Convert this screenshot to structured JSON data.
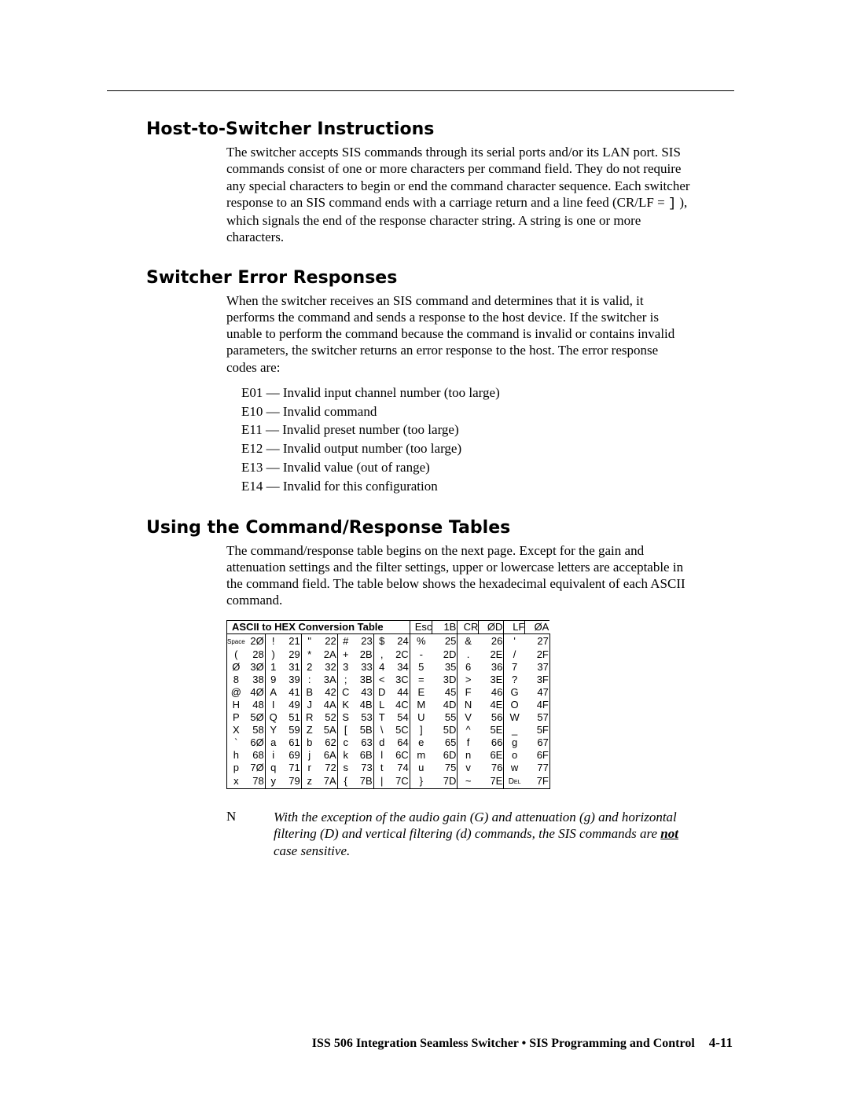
{
  "headings": {
    "h1": "Host-to-Switcher Instructions",
    "h2": "Switcher Error Responses",
    "h3": "Using the Command/Response Tables"
  },
  "paragraphs": {
    "p1a": "The switcher accepts SIS commands through its serial ports and/or its LAN port.  SIS commands consist of one or more characters per command field.  They do not require any special characters to begin or end the command character sequence.  Each switcher response to an SIS command ends with a carriage return and a line feed (CR/LF = ",
    "p1b": "), which signals the end of the response character string.  A string is one or more characters.",
    "crlf_symbol": "]",
    "p2": "When the switcher receives an SIS command and determines that it is valid, it performs the command and sends a response to the host device.  If the switcher is unable to perform the command because the command is invalid or contains invalid parameters, the switcher returns an error response to the host.  The error response codes are:",
    "p3": "The command/response table begins on the next page.  Except for the gain and attenuation settings and the filter settings, upper or lowercase letters are acceptable in the command field.  The table below shows the hexadecimal equivalent of each ASCII command."
  },
  "errors": [
    "E01 — Invalid input channel number (too large)",
    "E10 — Invalid command",
    "E11 — Invalid preset number (too large)",
    "E12 — Invalid output number (too large)",
    "E13 — Invalid value (out of range)",
    "E14 — Invalid for this configuration"
  ],
  "table": {
    "title": "ASCII to HEX  Conversion Table",
    "header_extras": [
      {
        "ch": "Esc",
        "hex": "1B"
      },
      {
        "ch": "CR",
        "hex": "ØD"
      },
      {
        "ch": "LF",
        "hex": "ØA"
      }
    ],
    "rows": [
      [
        {
          "ch": "Space",
          "hex": "2Ø"
        },
        {
          "ch": "!",
          "hex": "21"
        },
        {
          "ch": "\"",
          "hex": "22"
        },
        {
          "ch": "#",
          "hex": "23"
        },
        {
          "ch": "$",
          "hex": "24"
        },
        {
          "ch": "%",
          "hex": "25"
        },
        {
          "ch": "&",
          "hex": "26"
        },
        {
          "ch": "'",
          "hex": "27"
        }
      ],
      [
        {
          "ch": "(",
          "hex": "28"
        },
        {
          "ch": ")",
          "hex": "29"
        },
        {
          "ch": "*",
          "hex": "2A"
        },
        {
          "ch": "+",
          "hex": "2B"
        },
        {
          "ch": ",",
          "hex": "2C"
        },
        {
          "ch": "-",
          "hex": "2D"
        },
        {
          "ch": ".",
          "hex": "2E"
        },
        {
          "ch": "/",
          "hex": "2F"
        }
      ],
      [
        {
          "ch": "Ø",
          "hex": "3Ø"
        },
        {
          "ch": "1",
          "hex": "31"
        },
        {
          "ch": "2",
          "hex": "32"
        },
        {
          "ch": "3",
          "hex": "33"
        },
        {
          "ch": "4",
          "hex": "34"
        },
        {
          "ch": "5",
          "hex": "35"
        },
        {
          "ch": "6",
          "hex": "36"
        },
        {
          "ch": "7",
          "hex": "37"
        }
      ],
      [
        {
          "ch": "8",
          "hex": "38"
        },
        {
          "ch": "9",
          "hex": "39"
        },
        {
          "ch": ":",
          "hex": "3A"
        },
        {
          "ch": ";",
          "hex": "3B"
        },
        {
          "ch": "<",
          "hex": "3C"
        },
        {
          "ch": "=",
          "hex": "3D"
        },
        {
          "ch": ">",
          "hex": "3E"
        },
        {
          "ch": "?",
          "hex": "3F"
        }
      ],
      [
        {
          "ch": "@",
          "hex": "4Ø"
        },
        {
          "ch": "A",
          "hex": "41"
        },
        {
          "ch": "B",
          "hex": "42"
        },
        {
          "ch": "C",
          "hex": "43"
        },
        {
          "ch": "D",
          "hex": "44"
        },
        {
          "ch": "E",
          "hex": "45"
        },
        {
          "ch": "F",
          "hex": "46"
        },
        {
          "ch": "G",
          "hex": "47"
        }
      ],
      [
        {
          "ch": "H",
          "hex": "48"
        },
        {
          "ch": "I",
          "hex": "49"
        },
        {
          "ch": "J",
          "hex": "4A"
        },
        {
          "ch": "K",
          "hex": "4B"
        },
        {
          "ch": "L",
          "hex": "4C"
        },
        {
          "ch": "M",
          "hex": "4D"
        },
        {
          "ch": "N",
          "hex": "4E"
        },
        {
          "ch": "O",
          "hex": "4F"
        }
      ],
      [
        {
          "ch": "P",
          "hex": "5Ø"
        },
        {
          "ch": "Q",
          "hex": "51"
        },
        {
          "ch": "R",
          "hex": "52"
        },
        {
          "ch": "S",
          "hex": "53"
        },
        {
          "ch": "T",
          "hex": "54"
        },
        {
          "ch": "U",
          "hex": "55"
        },
        {
          "ch": "V",
          "hex": "56"
        },
        {
          "ch": "W",
          "hex": "57"
        }
      ],
      [
        {
          "ch": "X",
          "hex": "58"
        },
        {
          "ch": "Y",
          "hex": "59"
        },
        {
          "ch": "Z",
          "hex": "5A"
        },
        {
          "ch": "[",
          "hex": "5B"
        },
        {
          "ch": "\\",
          "hex": "5C"
        },
        {
          "ch": "]",
          "hex": "5D"
        },
        {
          "ch": "^",
          "hex": "5E"
        },
        {
          "ch": "_",
          "hex": "5F"
        }
      ],
      [
        {
          "ch": "`",
          "hex": "6Ø"
        },
        {
          "ch": "a",
          "hex": "61"
        },
        {
          "ch": "b",
          "hex": "62"
        },
        {
          "ch": "c",
          "hex": "63"
        },
        {
          "ch": "d",
          "hex": "64"
        },
        {
          "ch": "e",
          "hex": "65"
        },
        {
          "ch": "f",
          "hex": "66"
        },
        {
          "ch": "g",
          "hex": "67"
        }
      ],
      [
        {
          "ch": "h",
          "hex": "68"
        },
        {
          "ch": "i",
          "hex": "69"
        },
        {
          "ch": "j",
          "hex": "6A"
        },
        {
          "ch": "k",
          "hex": "6B"
        },
        {
          "ch": "l",
          "hex": "6C"
        },
        {
          "ch": "m",
          "hex": "6D"
        },
        {
          "ch": "n",
          "hex": "6E"
        },
        {
          "ch": "o",
          "hex": "6F"
        }
      ],
      [
        {
          "ch": "p",
          "hex": "7Ø"
        },
        {
          "ch": "q",
          "hex": "71"
        },
        {
          "ch": "r",
          "hex": "72"
        },
        {
          "ch": "s",
          "hex": "73"
        },
        {
          "ch": "t",
          "hex": "74"
        },
        {
          "ch": "u",
          "hex": "75"
        },
        {
          "ch": "v",
          "hex": "76"
        },
        {
          "ch": "w",
          "hex": "77"
        }
      ],
      [
        {
          "ch": "x",
          "hex": "78"
        },
        {
          "ch": "y",
          "hex": "79"
        },
        {
          "ch": "z",
          "hex": "7A"
        },
        {
          "ch": "{",
          "hex": "7B"
        },
        {
          "ch": "|",
          "hex": "7C"
        },
        {
          "ch": "}",
          "hex": "7D"
        },
        {
          "ch": "~",
          "hex": "7E"
        },
        {
          "ch": "Del",
          "hex": "7F"
        }
      ]
    ]
  },
  "note": {
    "label": "N",
    "text_a": "With the exception of the audio gain (G) and attenuation (g) and horizontal filtering (D) and vertical filtering (d) commands, the SIS commands are ",
    "not": "not",
    "text_b": " case sensitive."
  },
  "footer": {
    "main": "ISS 506 Integration Seamless Switcher • SIS Programming and Control",
    "page": "4-11"
  }
}
